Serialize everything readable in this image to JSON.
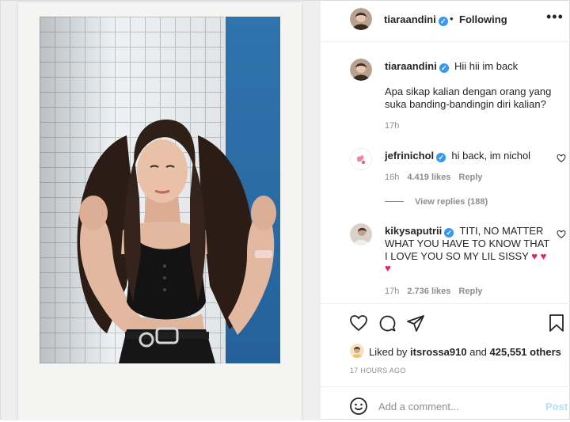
{
  "header": {
    "username": "tiaraandini",
    "separator": "•",
    "follow_status": "Following",
    "more_label": "•••"
  },
  "caption": {
    "username": "tiaraandini",
    "text": "Hii hii im back",
    "body": "Apa sikap kalian dengan orang yang suka banding-bandingin diri kalian?",
    "time": "17h"
  },
  "comments": [
    {
      "username": "jefrinichol",
      "text": "hi back, im nichol",
      "time": "16h",
      "likes": "4.419 likes",
      "reply_label": "Reply",
      "view_replies": "View replies (188)"
    },
    {
      "username": "kikysaputrii",
      "text": "TITI, NO MATTER WHAT YOU HAVE TO KNOW THAT I LOVE YOU SO MY LIL SISSY",
      "emoji": "♥ ♥ ♥",
      "time": "17h",
      "likes": "2.736 likes",
      "reply_label": "Reply"
    }
  ],
  "liked_by": {
    "prefix": "Liked by ",
    "user": "itsrossa910",
    "middle": " and ",
    "count": "425,551 others"
  },
  "date": "17 HOURS AGO",
  "comment_box": {
    "placeholder": "Add a comment...",
    "post_label": "Post"
  },
  "colors": {
    "verified": "#3897f0",
    "heart_emoji": "#e0245e",
    "post_disabled": "#b2dffc",
    "blue_wall": "#2a6aa3"
  },
  "icons": [
    "verified-icon",
    "more-icon",
    "heart-icon",
    "comment-icon",
    "share-icon",
    "bookmark-icon",
    "emoji-icon"
  ]
}
